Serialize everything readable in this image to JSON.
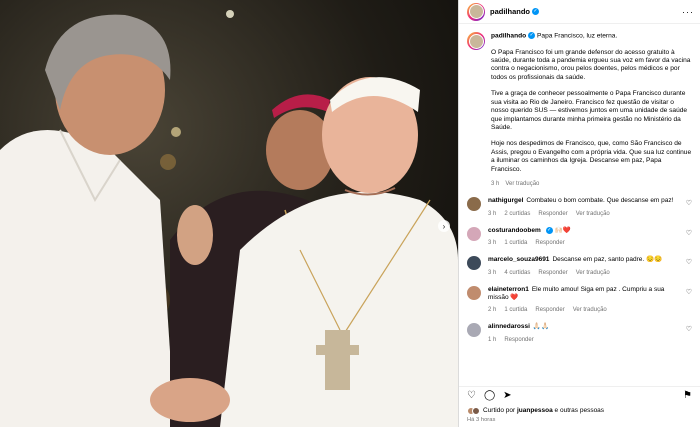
{
  "post": {
    "username": "padilhando",
    "caption_title": "Papa Francisco, luz eterna.",
    "paragraphs": [
      "O Papa Francisco foi um grande defensor do acesso gratuito à saúde, durante toda a pandemia ergueu sua voz em favor da vacina contra o negacionismo, orou pelos doentes, pelos médicos e por todos os profissionais da saúde.",
      "Tive a graça de conhecer pessoalmente o Papa Francisco durante sua visita ao Rio de Janeiro. Francisco fez questão de visitar o nosso querido SUS — estivemos juntos em uma unidade de saúde que implantamos durante minha primeira gestão no Ministério da Saúde.",
      "Hoje nos despedimos de Francisco, que, como São Francisco de Assis, pregou o Evangelho com a própria vida. Que sua luz continue a iluminar os caminhos da Igreja. Descanse em paz, Papa Francisco."
    ],
    "time": "3 h",
    "see_translation": "Ver tradução"
  },
  "comments": [
    {
      "user": "nathigurgel",
      "text": "Combateu o bom combate. Que descanse em paz!",
      "time": "3 h",
      "likes": "2 curtidas",
      "reply": "Responder",
      "translate": "Ver tradução",
      "color": "#8a6b4a"
    },
    {
      "user": "costurandoobem",
      "text": "🙌🏻❤️",
      "time": "3 h",
      "likes": "1 curtida",
      "reply": "Responder",
      "translate": "",
      "color": "#d4a7b8",
      "verified": true
    },
    {
      "user": "marcelo_souza9691",
      "text": "Descanse em paz, santo padre. 😔😔",
      "time": "3 h",
      "likes": "4 curtidas",
      "reply": "Responder",
      "translate": "Ver tradução",
      "color": "#3d4a5a"
    },
    {
      "user": "elaineterron1",
      "text": "Ele muito amou! Siga em paz . Cumpriu a sua missão ❤️",
      "time": "2 h",
      "likes": "1 curtida",
      "reply": "Responder",
      "translate": "Ver tradução",
      "color": "#c08c6e"
    },
    {
      "user": "alinnedarossi",
      "text": "🙏🏻🙏🏻",
      "time": "1 h",
      "likes": "",
      "reply": "Responder",
      "translate": "",
      "color": "#a9a9b4"
    }
  ],
  "footer": {
    "liked_by_prefix": "Curtido por",
    "liked_by_user": "juanpessoa",
    "liked_by_suffix": "e outras pessoas",
    "posted_ago": "Há 3 horas"
  },
  "icons": {
    "like": "heart-icon",
    "comment": "comment-icon",
    "share": "share-icon",
    "save": "bookmark-icon",
    "more": "more-options-icon",
    "next": "chevron-right-icon"
  }
}
